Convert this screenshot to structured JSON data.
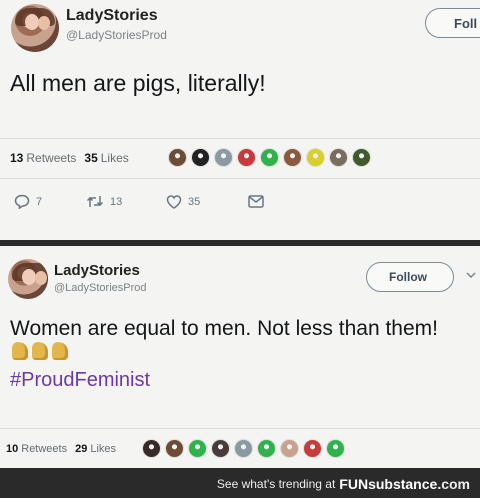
{
  "tweets": [
    {
      "name": "LadyStories",
      "handle": "@LadyStoriesProd",
      "follow_label": "Foll",
      "text": "All men are pigs, literally!",
      "retweet_count": "13",
      "retweet_word": "Retweets",
      "like_count": "35",
      "like_word": "Likes",
      "reply_action_count": "7",
      "retweet_action_count": "13",
      "like_action_count": "35",
      "liker_colors": [
        "#6d4b35",
        "#222222",
        "#8a9aa3",
        "#c93a3a",
        "#2db34a",
        "#8b5a3c",
        "#d8cf2a",
        "#7a6d5c",
        "#3f5a2d"
      ]
    },
    {
      "name": "LadyStories",
      "handle": "@LadyStoriesProd",
      "follow_label": "Follow",
      "text": "Women are equal to men. Not less than them!",
      "flex_emoji": "flexed-biceps",
      "hashtag": "#ProudFeminist",
      "retweet_count": "10",
      "retweet_word": "Retweets",
      "like_count": "29",
      "like_word": "Likes",
      "liker_colors": [
        "#3a2a26",
        "#6d4b35",
        "#2db34a",
        "#4b3a3a",
        "#8a9aa3",
        "#2db34a",
        "#c9a28f",
        "#c93a3a",
        "#2db34a"
      ]
    }
  ],
  "footer": {
    "prefix": "See what's trending at",
    "brand_fun": "FUN",
    "brand_sub": "substance",
    "brand_com": ".com"
  },
  "icons": {
    "reply": "reply-icon",
    "retweet": "retweet-icon",
    "like": "heart-icon",
    "dm": "envelope-icon",
    "chevron": "chevron-down-icon"
  }
}
